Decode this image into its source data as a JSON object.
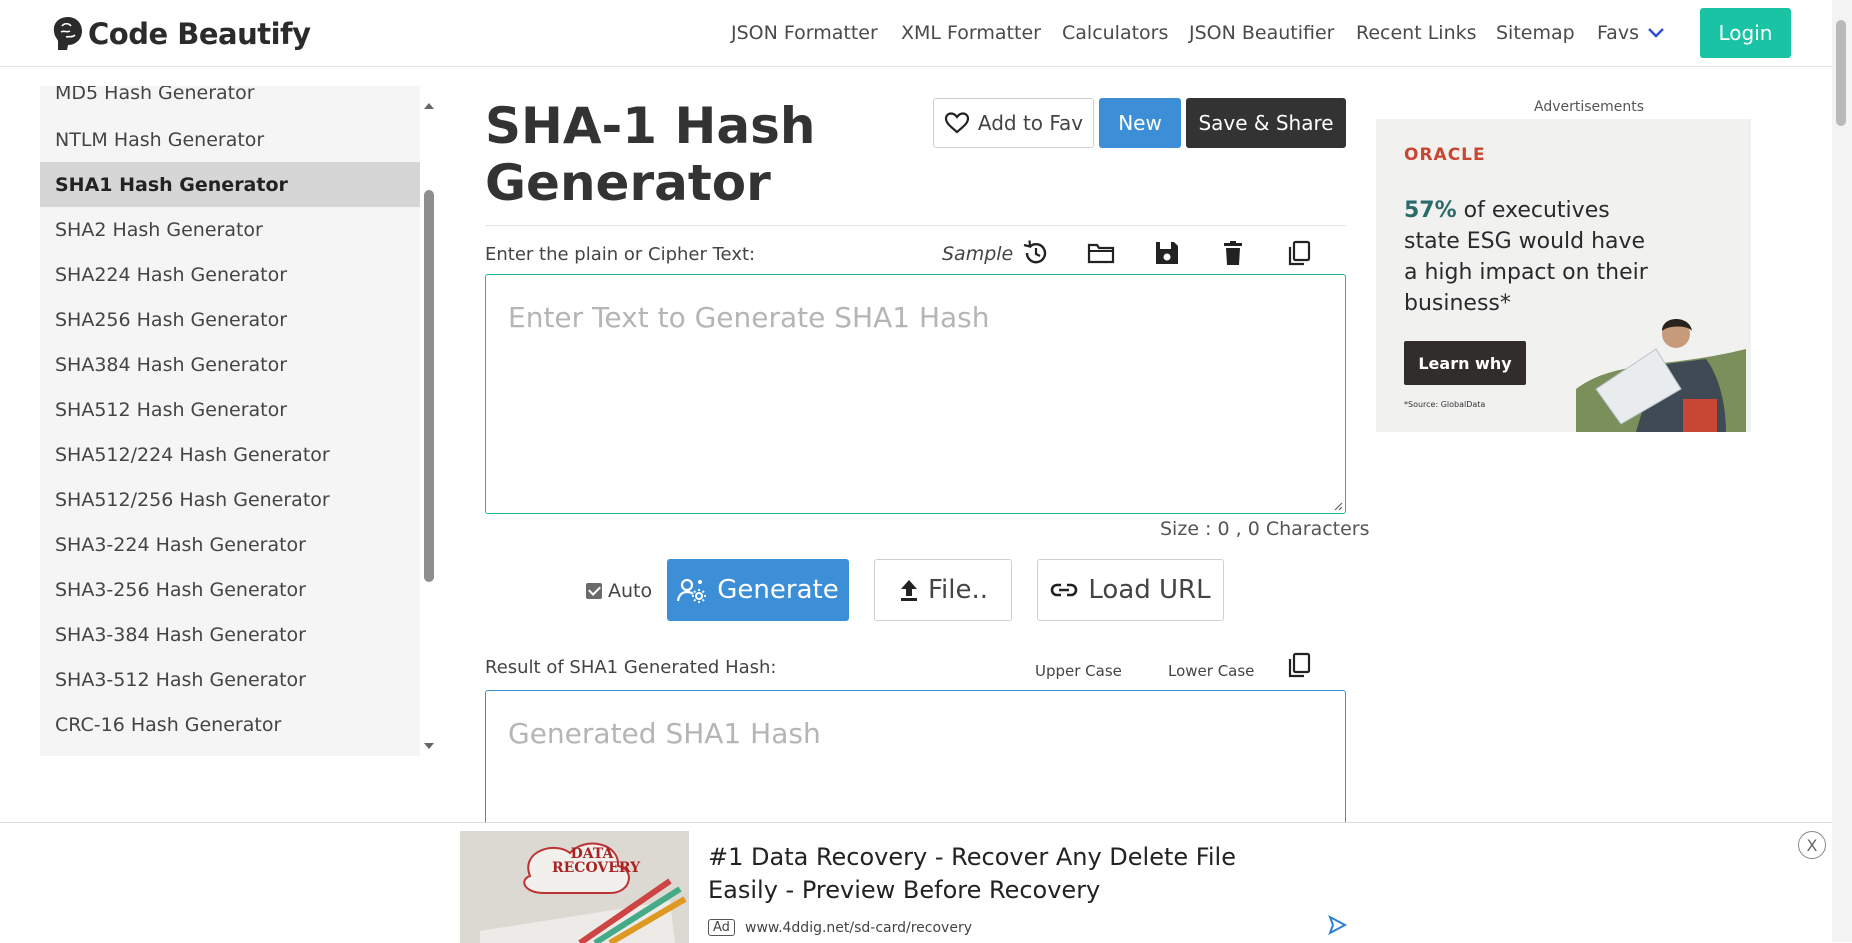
{
  "header": {
    "logo_text": "Code Beautify",
    "nav": [
      "JSON Formatter",
      "XML Formatter",
      "Calculators",
      "JSON Beautifier",
      "Recent Links",
      "Sitemap",
      "Favs"
    ],
    "login": "Login"
  },
  "sidebar": {
    "items": [
      {
        "label": "MD5 Hash Generator",
        "active": false
      },
      {
        "label": "NTLM Hash Generator",
        "active": false
      },
      {
        "label": "SHA1 Hash Generator",
        "active": true
      },
      {
        "label": "SHA2 Hash Generator",
        "active": false
      },
      {
        "label": "SHA224 Hash Generator",
        "active": false
      },
      {
        "label": "SHA256 Hash Generator",
        "active": false
      },
      {
        "label": "SHA384 Hash Generator",
        "active": false
      },
      {
        "label": "SHA512 Hash Generator",
        "active": false
      },
      {
        "label": "SHA512/224 Hash Generator",
        "active": false
      },
      {
        "label": "SHA512/256 Hash Generator",
        "active": false
      },
      {
        "label": "SHA3-224 Hash Generator",
        "active": false
      },
      {
        "label": "SHA3-256 Hash Generator",
        "active": false
      },
      {
        "label": "SHA3-384 Hash Generator",
        "active": false
      },
      {
        "label": "SHA3-512 Hash Generator",
        "active": false
      },
      {
        "label": "CRC-16 Hash Generator",
        "active": false
      }
    ]
  },
  "main": {
    "title": "SHA-1 Hash Generator",
    "add_fav": "Add to Fav",
    "new": "New",
    "save_share": "Save & Share",
    "input_label": "Enter the plain or Cipher Text:",
    "sample": "Sample",
    "input_placeholder": "Enter Text to Generate SHA1 Hash",
    "size_text": "Size : 0 , 0 Characters",
    "auto_label": "Auto",
    "auto_checked": true,
    "generate": "Generate",
    "file": "File..",
    "load_url": "Load URL",
    "result_label": "Result of SHA1 Generated Hash:",
    "upper_case": "Upper Case",
    "lower_case": "Lower Case",
    "result_placeholder": "Generated SHA1 Hash"
  },
  "right_ad": {
    "label": "Advertisements",
    "brand": "ORACLE",
    "headline_pct": "57%",
    "headline_rest": "of executives state ESG would have a high impact on their business*",
    "cta": "Learn why",
    "source": "*Source: GlobalData"
  },
  "bottom_ad": {
    "title": "#1 Data Recovery - Recover Any Delete File Easily - Preview Before Recovery",
    "ad_tag": "Ad",
    "url": "www.4ddig.net/sd-card/recovery",
    "image_text": "DATA RECOVERY",
    "close": "X"
  },
  "colors": {
    "accent_teal": "#19c3a4",
    "accent_blue": "#3c8fd6",
    "dark_button": "#333333",
    "oracle_red": "#c74634"
  }
}
